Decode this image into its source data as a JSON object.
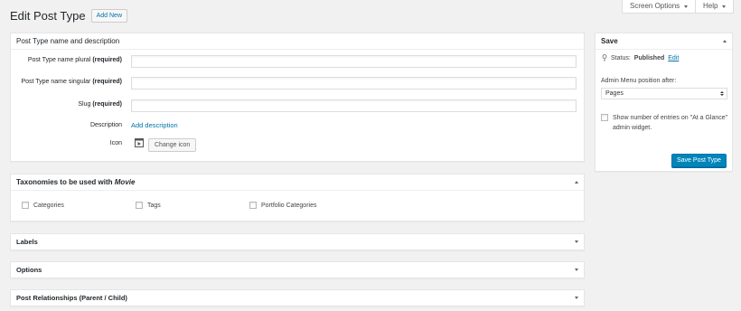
{
  "header": {
    "title": "Edit Post Type",
    "add_new": "Add New"
  },
  "screen_tabs": {
    "screen_options": "Screen Options",
    "help": "Help"
  },
  "main_panel": {
    "title": "Post Type name and description",
    "fields": {
      "plural_label": "Post Type name plural",
      "singular_label": "Post Type name singular",
      "slug_label": "Slug",
      "required": "(required)",
      "plural_value": "",
      "singular_value": "",
      "slug_value": ""
    },
    "description_label": "Description",
    "description_link": "Add description",
    "icon_label": "Icon",
    "change_icon": "Change icon"
  },
  "taxonomies": {
    "title_prefix": "Taxonomies to be used with",
    "title_post_type": "Movie",
    "items": [
      {
        "label": "Categories",
        "checked": false
      },
      {
        "label": "Tags",
        "checked": false
      },
      {
        "label": "Portfolio Categories",
        "checked": false
      }
    ]
  },
  "sections": {
    "labels": "Labels",
    "options": "Options",
    "relationships": "Post Relationships (Parent / Child)"
  },
  "save_box": {
    "title": "Save",
    "status_label": "Status:",
    "status_value": "Published",
    "status_edit": "Edit",
    "menu_position_label": "Admin Menu position after:",
    "menu_position_value": "Pages",
    "show_entries_label": "Show number of entries on \"At a Glance\" admin widget.",
    "show_entries_checked": false,
    "save_button": "Save Post Type"
  },
  "colors": {
    "primary": "#0085ba",
    "link": "#0073aa",
    "background": "#f1f1f1"
  }
}
